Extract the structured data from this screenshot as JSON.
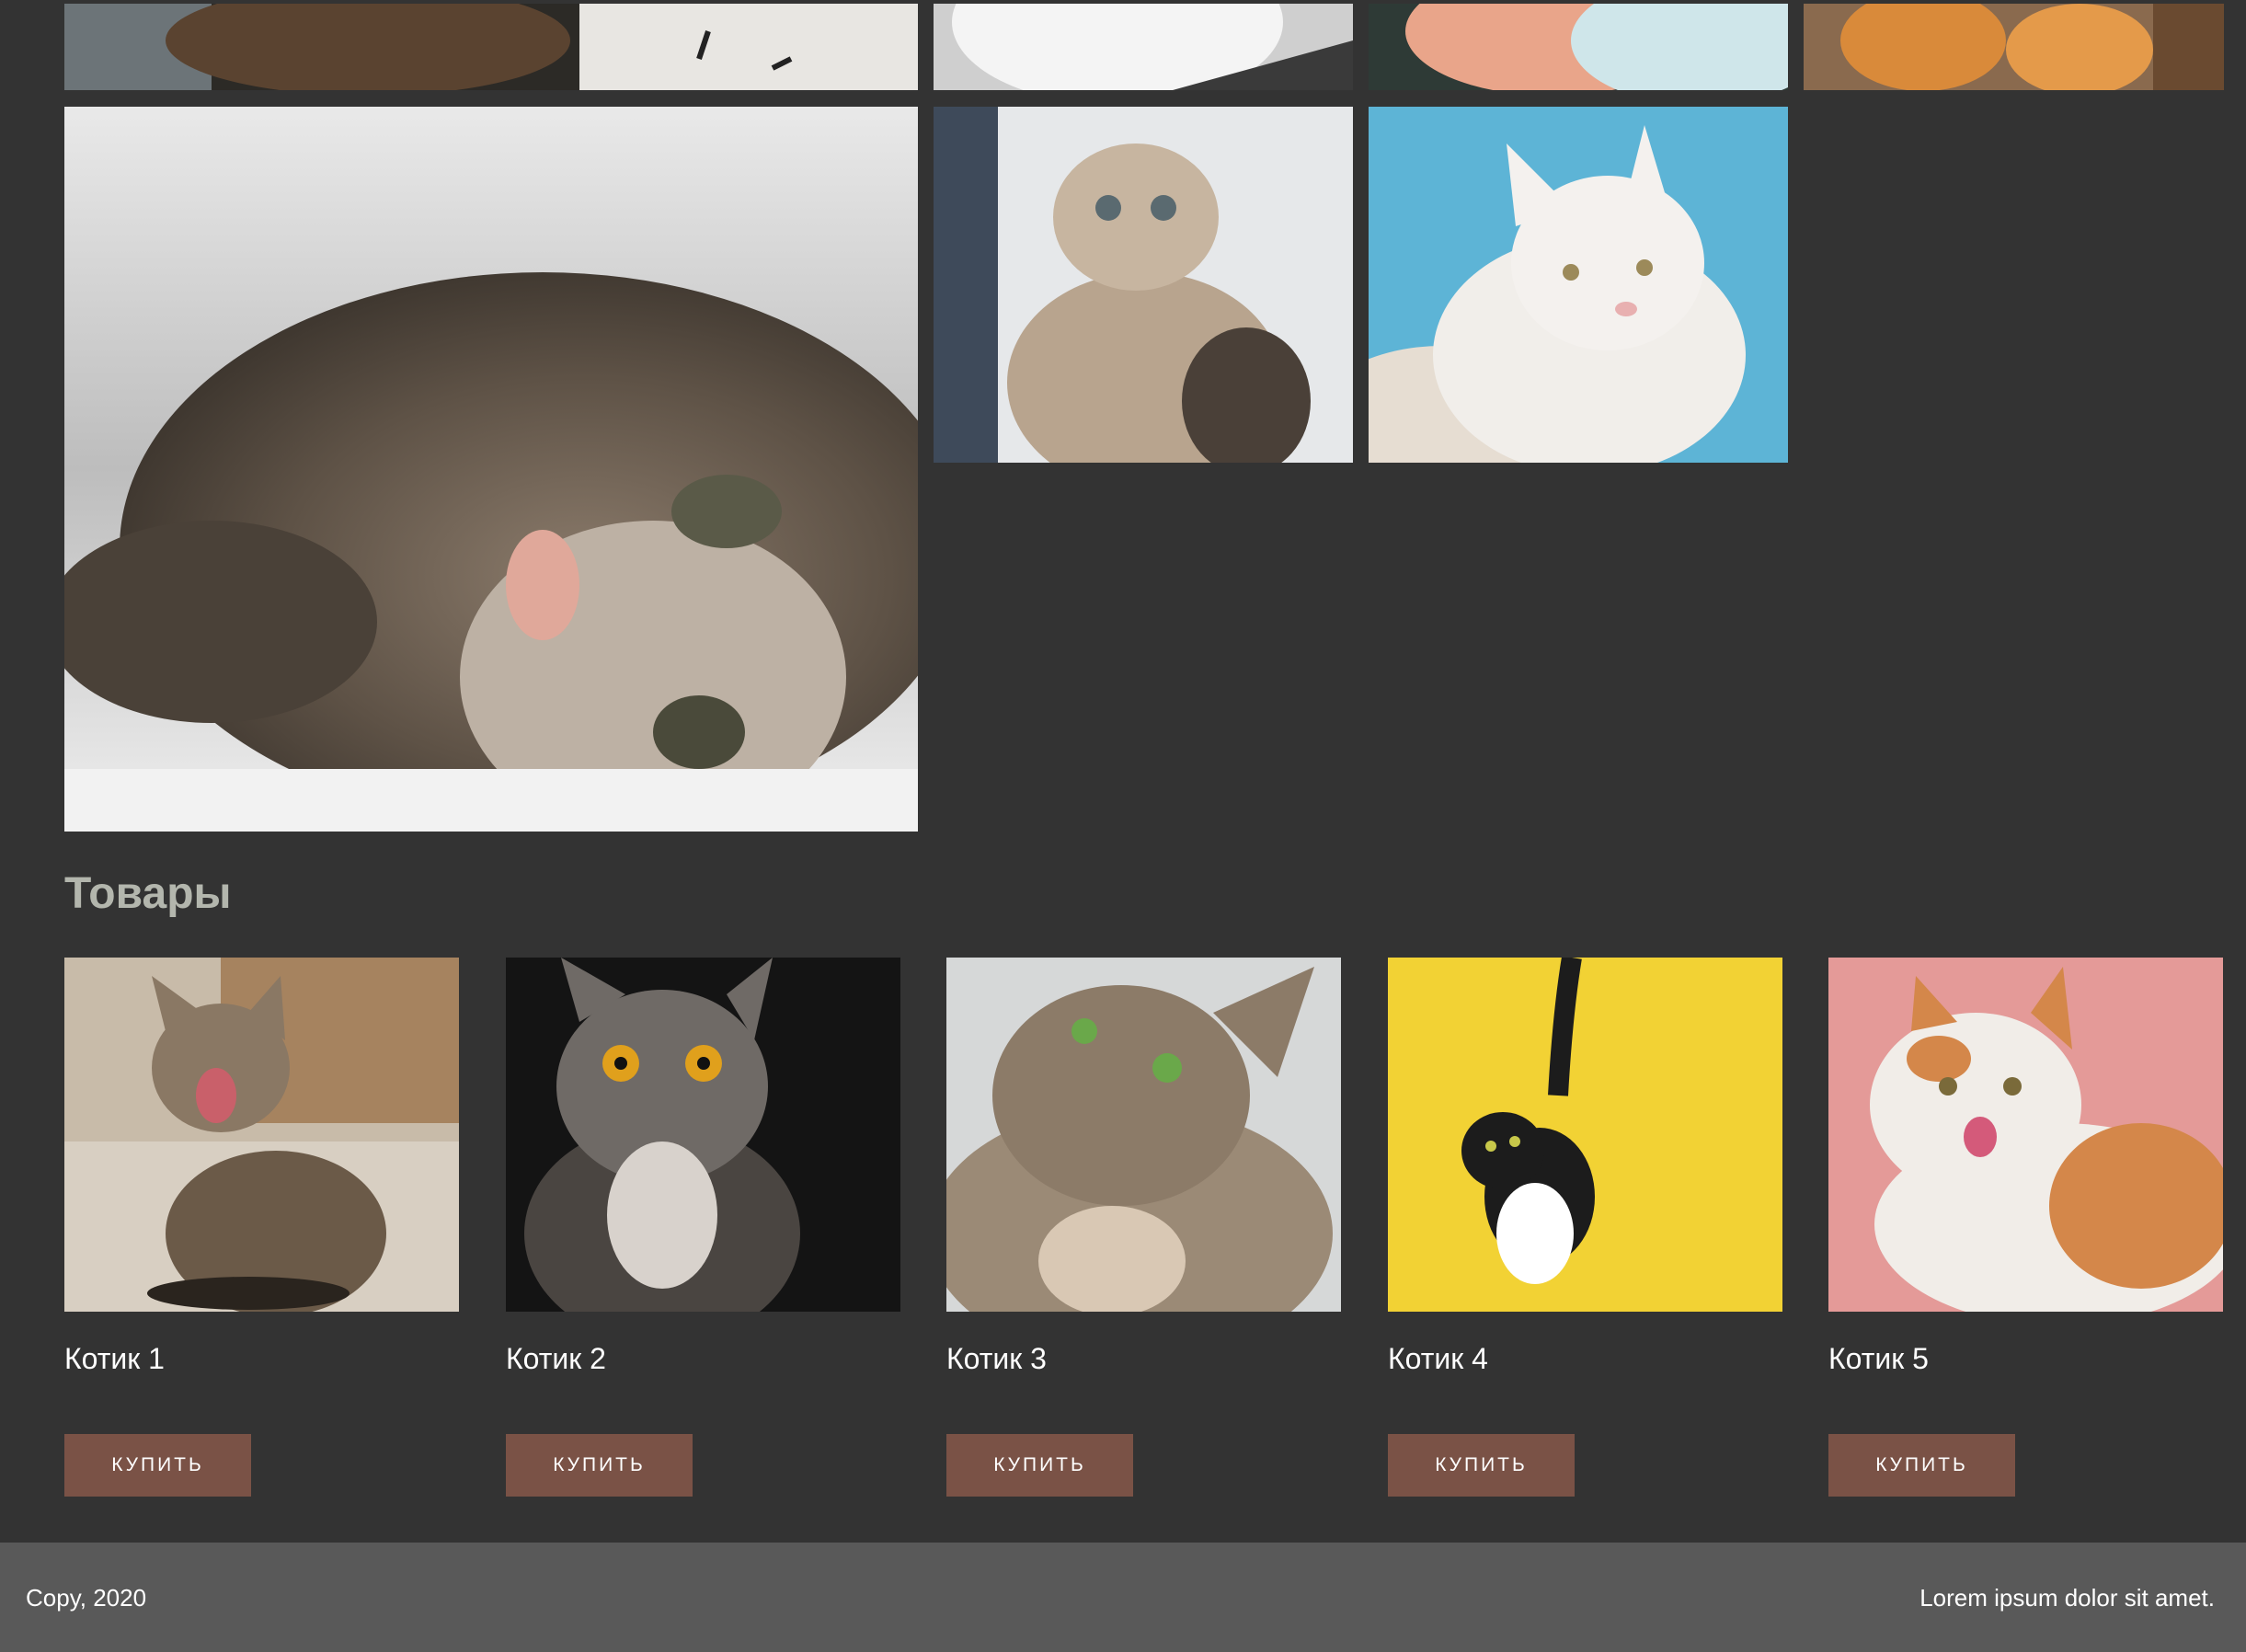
{
  "gallery": {
    "images": [
      {
        "name": "tabby cat on paper",
        "colors": [
          "#2c2a26",
          "#8a6a4a",
          "#e8e6e2"
        ]
      },
      {
        "name": "white cat chest",
        "colors": [
          "#f2f2f2",
          "#3a3a3a",
          "#cfcfcf"
        ]
      },
      {
        "name": "cream cat fur",
        "colors": [
          "#2e3a36",
          "#e9a58a",
          "#cfe6ea"
        ]
      },
      {
        "name": "ginger cat paws",
        "colors": [
          "#6a4a30",
          "#d98a3a",
          "#f2e6d8"
        ]
      },
      {
        "name": "tabby cat lying on side",
        "colors": [
          "#d9d9d9",
          "#6e6256",
          "#3b342e"
        ]
      },
      {
        "name": "fluffy kitten by window",
        "colors": [
          "#e6e8ea",
          "#b8a48e",
          "#3e4a5a"
        ]
      },
      {
        "name": "white cat on blue background",
        "colors": [
          "#5db4d6",
          "#f4f1ee",
          "#e6ddd2"
        ]
      }
    ]
  },
  "products": {
    "title": "Товары",
    "items": [
      {
        "name": "Котик 1",
        "button": "КУПИТЬ",
        "bg": "#b8ab9a",
        "cat": "#6b5a48"
      },
      {
        "name": "Котик 2",
        "button": "КУПИТЬ",
        "bg": "#141414",
        "cat": "#6f6a66"
      },
      {
        "name": "Котик 3",
        "button": "КУПИТЬ",
        "bg": "#d6d8d8",
        "cat": "#8c7b68"
      },
      {
        "name": "Котик 4",
        "button": "КУПИТЬ",
        "bg": "#f2d234",
        "cat": "#1c1c1c"
      },
      {
        "name": "Котик 5",
        "button": "КУПИТЬ",
        "bg": "#e49a98",
        "cat": "#f1ede8"
      }
    ]
  },
  "footer": {
    "copy": "Copy, 2020",
    "text": "Lorem ipsum dolor sit amet."
  },
  "colors": {
    "background": "#333333",
    "footer": "#595959",
    "button": "#7a5246",
    "title": "#b3b6ad"
  }
}
